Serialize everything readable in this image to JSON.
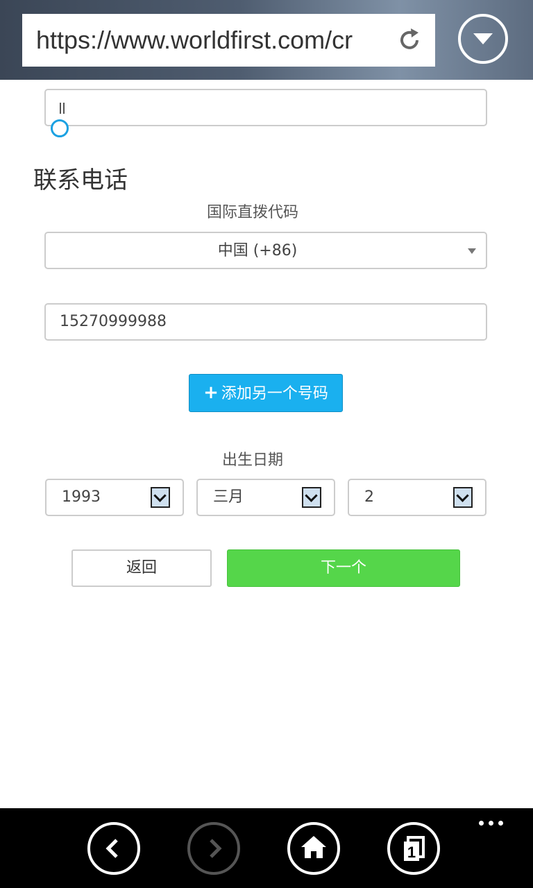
{
  "browser": {
    "url": "https://www.worldfirst.com/cr",
    "refresh_icon": "refresh-icon",
    "menu_icon": "chevron-down-circle-icon"
  },
  "form": {
    "text_field_value": "||",
    "section_title": "联系电话",
    "dial_code_label": "国际直拨代码",
    "dial_code_value": "中国 (+86)",
    "phone_value": "15270999988",
    "add_number_label": "添加另一个号码",
    "birth_date_label": "出生日期",
    "birth_year": "1993",
    "birth_month": "三月",
    "birth_day": "2",
    "back_label": "返回",
    "next_label": "下一个"
  },
  "colors": {
    "primary_blue": "#1ab0ef",
    "next_green": "#55d64a",
    "caret_blue": "#1ba1e2"
  },
  "appbar": {
    "icons": [
      "back-icon",
      "forward-icon",
      "home-icon",
      "tabs-icon",
      "more-icon"
    ],
    "tab_count": "1"
  }
}
